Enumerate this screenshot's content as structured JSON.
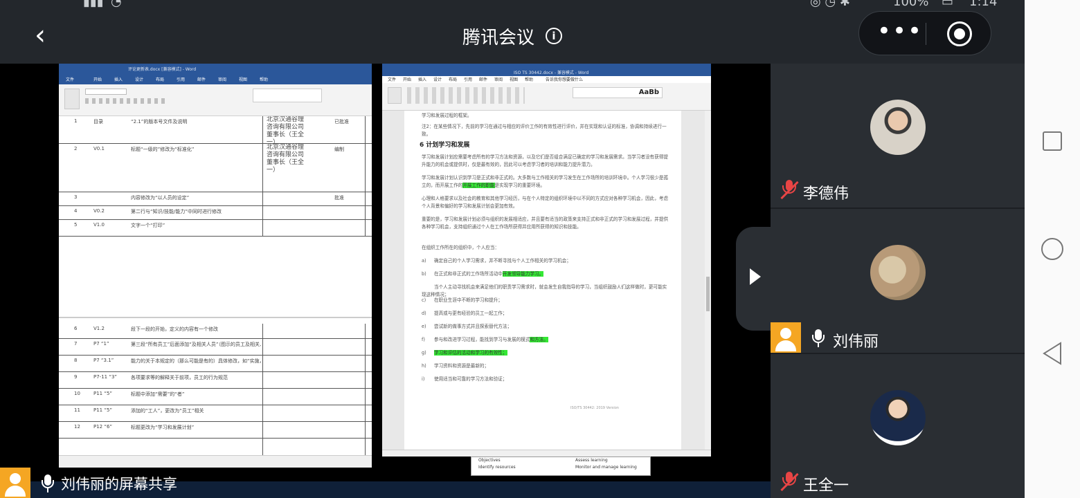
{
  "status_bar": {
    "battery_text": "100%",
    "time": "1:14"
  },
  "header": {
    "title": "腾讯会议"
  },
  "share": {
    "label": "刘伟丽的屏幕共享",
    "left_doc": {
      "title_bar": "评论更新表.docx [兼容模式] - Word",
      "tabs": [
        "文件",
        "开始",
        "插入",
        "设计",
        "布局",
        "引用",
        "邮件",
        "审阅",
        "视图",
        "帮助"
      ],
      "rows": [
        {
          "no": "1",
          "ver": "目录",
          "change": "“2.1”的版本号文件及说明",
          "approver": "北京汉通谷理咨询有限公司董事长（王全一）",
          "date": "已批准"
        },
        {
          "no": "2",
          "ver": "V0.1",
          "change": "标题“一级的”修改为“标准化”",
          "approver": "北京汉通谷理咨询有限公司董事长（王全一）",
          "date": "编制"
        },
        {
          "no": "3",
          "ver": "",
          "change": "内容修改为“以人员的设定”",
          "approver": "",
          "date": "批准"
        },
        {
          "no": "4",
          "ver": "V0.2",
          "change": "第二行与“知识/技能/能力”中同时进行修改",
          "approver": "",
          "date": ""
        },
        {
          "no": "5",
          "ver": "V1.0",
          "change": "文字一个“打印”",
          "approver": "",
          "date": ""
        },
        {
          "no": "6",
          "ver": "V1.2",
          "change": "段下一段的开始，定义的内容有一个修改",
          "approver": "",
          "date": ""
        },
        {
          "no": "7",
          "ver": "P7 “1”",
          "change": "第三段“所有员工”后面添加“及相关人员”（图示的员工及相关人员）",
          "approver": "",
          "date": ""
        },
        {
          "no": "8",
          "ver": "P7 “3.1”",
          "change": "能力的关于本规定的（那么可能是有的）具体修改，如“实施，建立相关能力”",
          "approver": "",
          "date": ""
        },
        {
          "no": "9",
          "ver": "P7-11 “3”",
          "change": "各项要求等的解释关于前项，员工的行为规范",
          "approver": "",
          "date": ""
        },
        {
          "no": "10",
          "ver": "P11 “5”",
          "change": "标题中添加“需要”的“者”",
          "approver": "",
          "date": ""
        },
        {
          "no": "11",
          "ver": "P11 “5”",
          "change": "添加的“工人”，更改为“员工”相关",
          "approver": "",
          "date": ""
        },
        {
          "no": "12",
          "ver": "P12 “6”",
          "change": "标题更改为“学习和发展计划”",
          "approver": "",
          "date": ""
        }
      ]
    },
    "right_doc": {
      "title_bar": "ISO TS 30442.docx - 兼容模式 - Word",
      "tabs": [
        "文件",
        "开始",
        "插入",
        "设计",
        "布局",
        "引用",
        "邮件",
        "审阅",
        "视图",
        "帮助",
        "告诉我你想要做什么"
      ],
      "note_top": "学习和发展过程的框架。",
      "note": "注2：在某些情况下，先前的学习在通过与相应的评价工作的有效性进行评价，并在实现和认证的标准，协调和持续进行一致。",
      "heading": "6 计划学习和发展",
      "paragraphs": [
        "学习和发展计划应需要考虑所有的学习方法和资源，以及它们是否组合满足已确定的学习和发展需求。当学习者没有获得提升能力的机会或提供时，仅是最有效的，因此可以考虑学习者的培训和能力提升潜力。",
        "学习和发展计划认识到学习是正式和非正式的。大多数与工作相关的学习发生在工作场所的培训环境中。个人学习很少是孤立的，而开展工作的",
        "心理和人格要求以及社会的教育和其他学习经历，与在个人特定的组织环境中以不同的方式应对各种学习机会，因此，考虑个人背景和偏好的学习和发展计划会更加有效。",
        "重要的是，学习和发展计划必须与组织的发展相适应，并且要有适当的政策来支持正式和非正式的学习和发展过程，并提供各种学习机会，支持组织通过个人在工作场所获得并应用所获得的知识和技能。",
        "在组织工作所在的组织中，个人应当："
      ],
      "para2_hl": "开展工作的职能",
      "para2_tail": "是实现学习的重要环境。",
      "list": [
        {
          "marker": "a)",
          "text": "确定自己的个人学习需求，并不断寻找与个人工作相关的学习机会；",
          "hl": ""
        },
        {
          "marker": "b)",
          "text": "在正式和非正式的工作场所活动中",
          "hl": "开发领导能力学习。"
        },
        {
          "marker": "",
          "text": "当个人主动寻找机会来满足他们的职责学习需求时，就会发生自我指导的学习，当组织鼓励人们这样做时，更可能实现这种情况；",
          "hl": ""
        },
        {
          "marker": "c)",
          "text": "在职业生涯中不断的学习和提升；",
          "hl": ""
        },
        {
          "marker": "d)",
          "text": "提高或与更有经验的员工一起工作；",
          "hl": ""
        },
        {
          "marker": "e)",
          "text": "尝试新的做事方式并且探索替代方法；",
          "hl": ""
        },
        {
          "marker": "f)",
          "text": "参与和改进学习过程，能找到学习与发展的模式",
          "hl": "和方法。"
        },
        {
          "marker": "g)",
          "text": "",
          "hl": "学习和评估的活动和学习的有效性；"
        },
        {
          "marker": "h)",
          "text": "学习资料和资源是最新的；",
          "hl": ""
        },
        {
          "marker": "i)",
          "text": "使用适当和可靠的学习方法和验证；",
          "hl": ""
        }
      ],
      "footer": "ISO/TS 30442: 2019 Version",
      "bottom_bullets": [
        "Objectives",
        "Identify resources",
        "Assess learning",
        "Monitor and manage learning"
      ]
    }
  },
  "participants": [
    {
      "name": "李德伟",
      "muted": true
    },
    {
      "name": "刘伟丽",
      "muted": false,
      "sharing": true
    },
    {
      "name": "王全一",
      "muted": true
    }
  ],
  "colors": {
    "bg": "#1c1f23",
    "tile": "#2a2e33",
    "word_blue": "#2b579a",
    "highlight": "#34e834",
    "avatar_orange": "#f5a623"
  }
}
